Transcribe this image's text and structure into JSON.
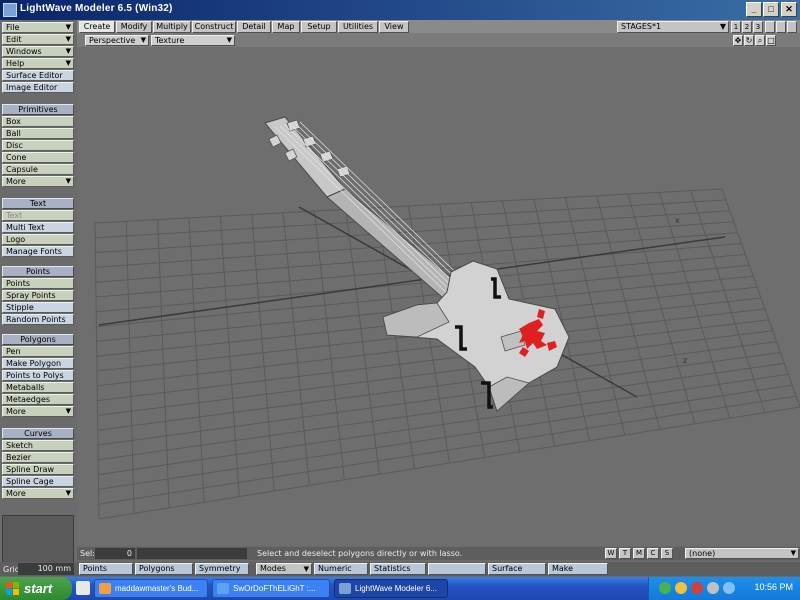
{
  "window": {
    "title": "LightWave Modeler 6.5 (Win32)",
    "minimize": "_",
    "maximize": "□",
    "close": "✕"
  },
  "left_panel": {
    "menus": [
      {
        "label": "File"
      },
      {
        "label": "Edit"
      },
      {
        "label": "Windows"
      },
      {
        "label": "Help"
      },
      {
        "label": "Surface Editor"
      },
      {
        "label": "Image Editor"
      }
    ],
    "primitives": {
      "header": "Primitives",
      "items": [
        "Box",
        "Ball",
        "Disc",
        "Cone",
        "Capsule",
        "More"
      ]
    },
    "text": {
      "header": "Text",
      "items": [
        "Text",
        "Multi Text",
        "Logo",
        "Manage Fonts"
      ]
    },
    "points": {
      "header": "Points",
      "items": [
        "Points",
        "Spray Points",
        "Stipple",
        "Random Points"
      ]
    },
    "polygons": {
      "header": "Polygons",
      "items": [
        "Pen",
        "Make Polygon",
        "Points to Polys",
        "Metaballs",
        "Metaedges",
        "More"
      ]
    },
    "curves": {
      "header": "Curves",
      "items": [
        "Sketch",
        "Bezier",
        "Spline Draw",
        "Spline Cage",
        "More"
      ]
    }
  },
  "toolbar": {
    "tabs": [
      "Create",
      "Modify",
      "Multiply",
      "Construct",
      "Detail",
      "Map",
      "Setup",
      "Utilities",
      "View"
    ],
    "active_tab": "Create",
    "stages": "STAGES*1"
  },
  "viewport": {
    "view": "Perspective",
    "render": "Texture"
  },
  "status": {
    "sel_label": "Sel:",
    "sel_value": "0",
    "hint": "Select and deselect polygons directly or with lasso.",
    "modes": [
      "W",
      "T",
      "M",
      "C",
      "S"
    ],
    "surface": "(none)"
  },
  "bottom": {
    "grid_label": "Grid:",
    "grid_value": "100 mm",
    "buttons": [
      "Points",
      "Polygons",
      "Symmetry",
      "Modes",
      "Numeric",
      "Statistics",
      "Surface",
      "Make"
    ]
  },
  "taskbar": {
    "start": "start",
    "tasks": [
      "maddawmaster's Bud...",
      "SwOrDoFThELiGhT :...",
      "LightWave Modeler 6..."
    ],
    "clock": "10:56 PM"
  },
  "colors": {
    "title_bar": "#0a246a",
    "viewport_bg": "#6e6e6e",
    "button_green": "#c7d1bd",
    "button_blue": "#c9d5e2",
    "decal_red": "#e02020",
    "taskbar": "#2459c8"
  }
}
